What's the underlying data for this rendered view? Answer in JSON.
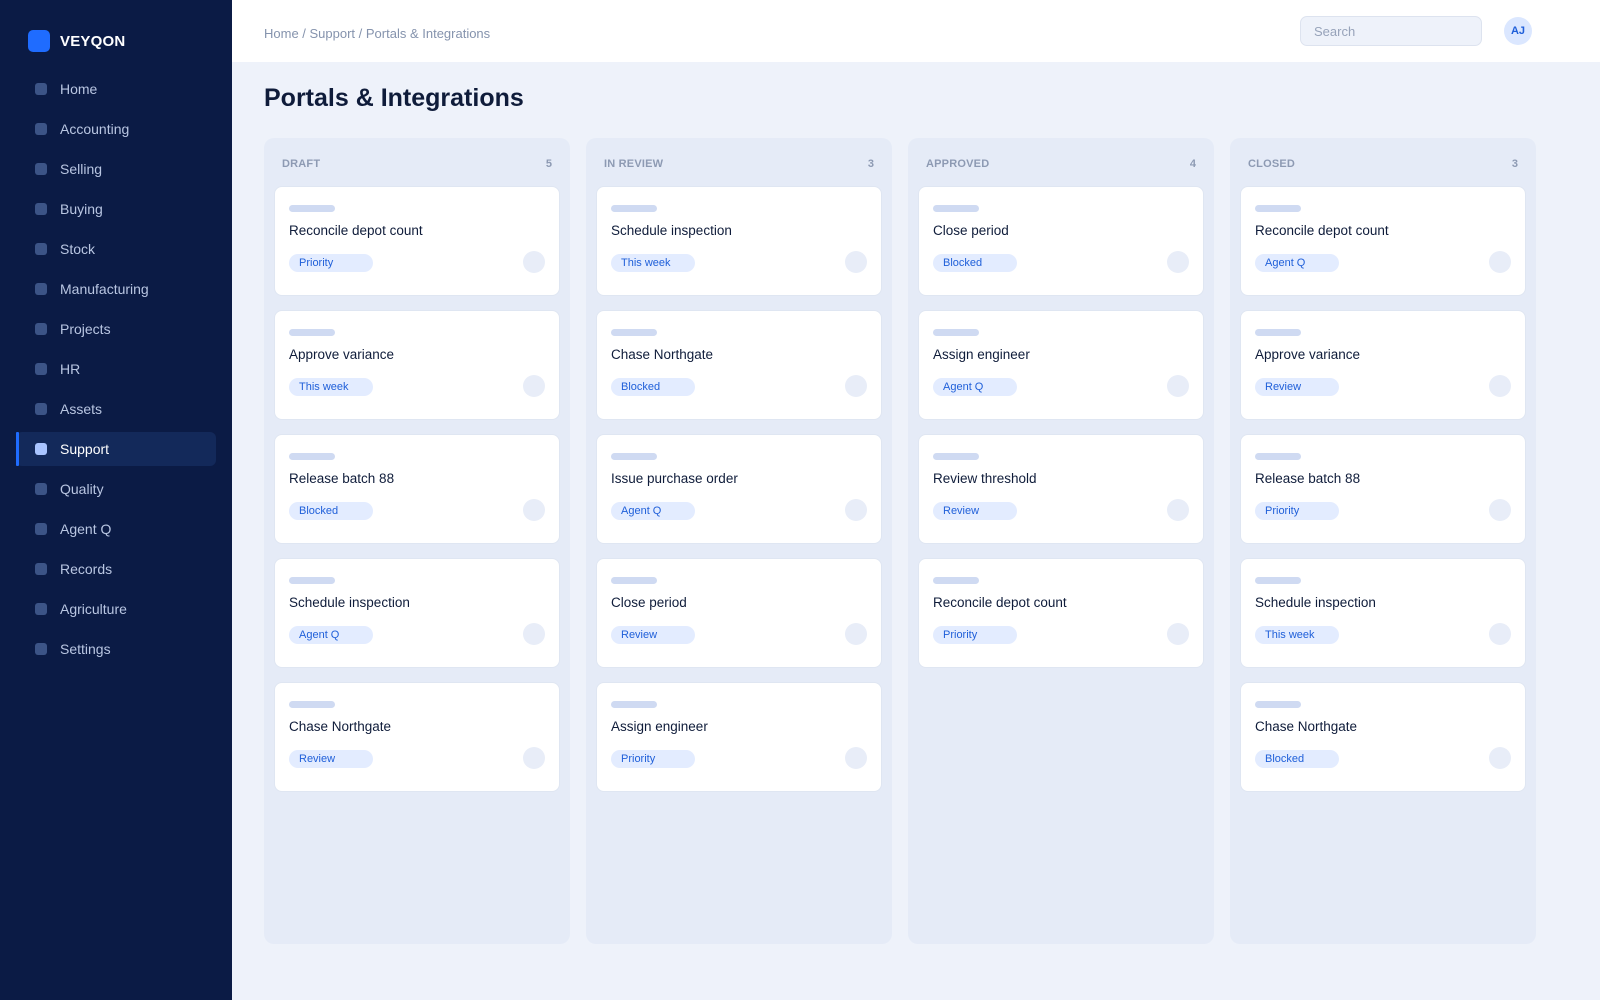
{
  "app": {
    "brand": "VEYQON"
  },
  "sidebar": {
    "items": [
      {
        "label": "Home",
        "name": "home"
      },
      {
        "label": "Accounting",
        "name": "accounting"
      },
      {
        "label": "Selling",
        "name": "selling"
      },
      {
        "label": "Buying",
        "name": "buying"
      },
      {
        "label": "Stock",
        "name": "stock"
      },
      {
        "label": "Manufacturing",
        "name": "manufacturing"
      },
      {
        "label": "Projects",
        "name": "projects"
      },
      {
        "label": "HR",
        "name": "hr"
      },
      {
        "label": "Assets",
        "name": "assets"
      },
      {
        "label": "Support",
        "name": "support",
        "active": true
      },
      {
        "label": "Quality",
        "name": "quality"
      },
      {
        "label": "Agent Q",
        "name": "agent-q"
      },
      {
        "label": "Records",
        "name": "records"
      },
      {
        "label": "Agriculture",
        "name": "agriculture"
      },
      {
        "label": "Settings",
        "name": "settings"
      }
    ]
  },
  "header": {
    "breadcrumb": "Home / Support / Portals & Integrations",
    "search_placeholder": "Search",
    "search_value": "",
    "avatar_initials": "AJ"
  },
  "page": {
    "title": "Portals & Integrations"
  },
  "board": {
    "columns": [
      {
        "title": "DRAFT",
        "count": "5",
        "cards": [
          {
            "title": "Reconcile depot count",
            "tag": "Priority"
          },
          {
            "title": "Approve variance",
            "tag": "This week"
          },
          {
            "title": "Release batch 88",
            "tag": "Blocked"
          },
          {
            "title": "Schedule inspection",
            "tag": "Agent Q"
          },
          {
            "title": "Chase Northgate",
            "tag": "Review"
          }
        ]
      },
      {
        "title": "IN REVIEW",
        "count": "3",
        "cards": [
          {
            "title": "Schedule inspection",
            "tag": "This week"
          },
          {
            "title": "Chase Northgate",
            "tag": "Blocked"
          },
          {
            "title": "Issue purchase order",
            "tag": "Agent Q"
          },
          {
            "title": "Close period",
            "tag": "Review"
          },
          {
            "title": "Assign engineer",
            "tag": "Priority"
          }
        ]
      },
      {
        "title": "APPROVED",
        "count": "4",
        "cards": [
          {
            "title": "Close period",
            "tag": "Blocked"
          },
          {
            "title": "Assign engineer",
            "tag": "Agent Q"
          },
          {
            "title": "Review threshold",
            "tag": "Review"
          },
          {
            "title": "Reconcile depot count",
            "tag": "Priority"
          }
        ]
      },
      {
        "title": "CLOSED",
        "count": "3",
        "cards": [
          {
            "title": "Reconcile depot count",
            "tag": "Agent Q"
          },
          {
            "title": "Approve variance",
            "tag": "Review"
          },
          {
            "title": "Release batch 88",
            "tag": "Priority"
          },
          {
            "title": "Schedule inspection",
            "tag": "This week"
          },
          {
            "title": "Chase Northgate",
            "tag": "Blocked"
          }
        ]
      }
    ]
  },
  "colors": {
    "sidebar_bg": "#0b1b45",
    "accent": "#1f6cff",
    "page_bg": "#eef2fa",
    "tag_bg": "#e3ecff",
    "tag_text": "#1f5fd9"
  }
}
